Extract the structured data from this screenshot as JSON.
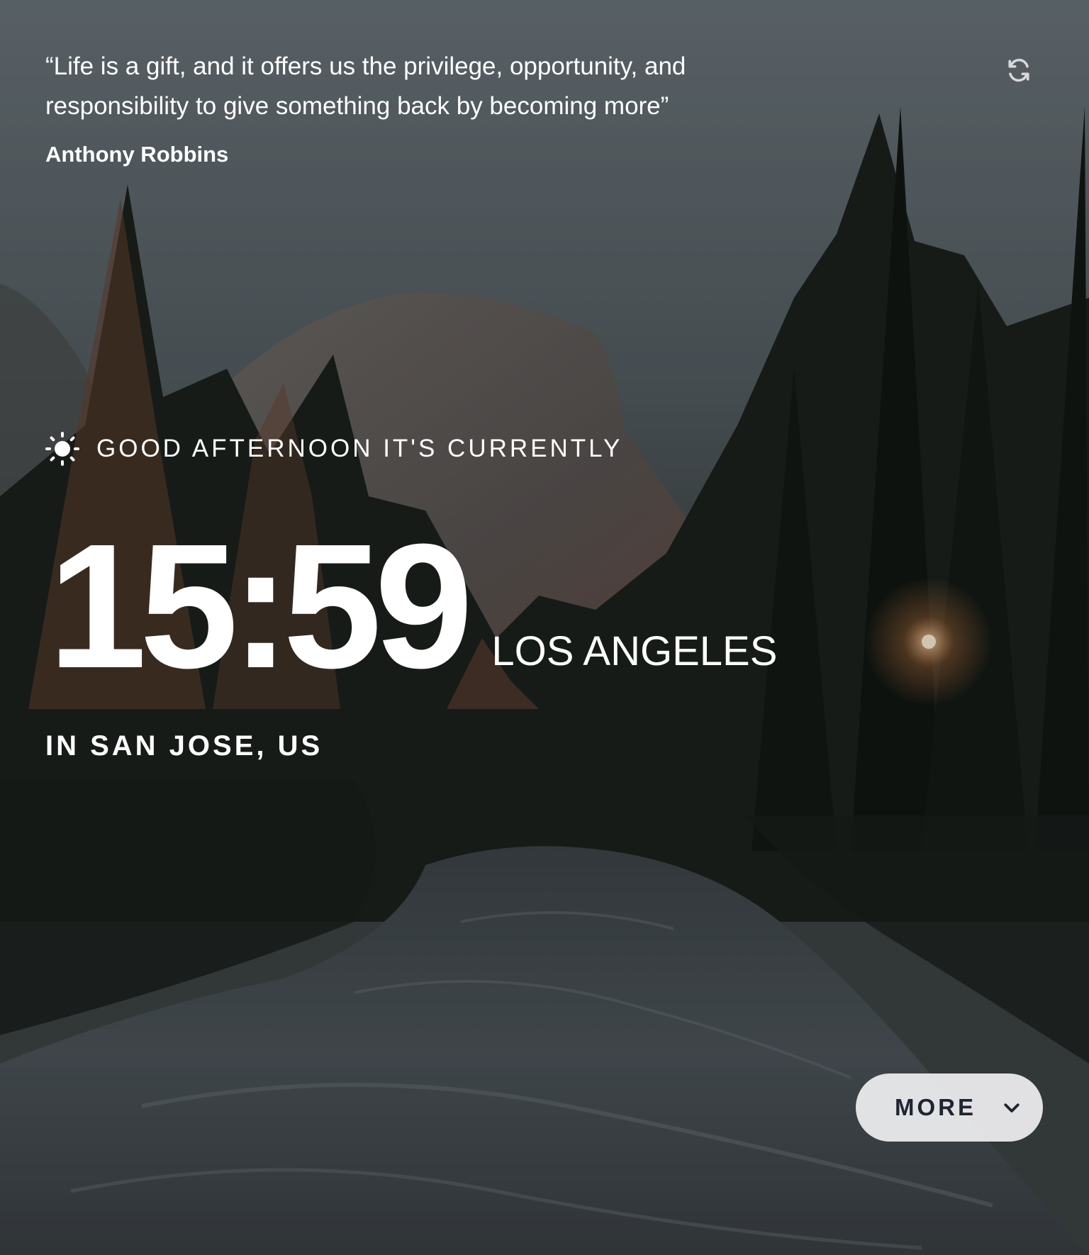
{
  "quote": {
    "text": "“Life is a gift, and it offers us the privilege, opportunity, and responsibility to give something back by becoming more”",
    "author": "Anthony Robbins",
    "refresh_icon": "refresh-icon"
  },
  "greeting": {
    "icon": "sun-icon",
    "text": "GOOD AFTERNOON IT'S CURRENTLY"
  },
  "clock": {
    "time": "15:59",
    "timezone": "LOS ANGELES"
  },
  "location": {
    "text": "IN SAN JOSE, US"
  },
  "more_button": {
    "label": "MORE",
    "icon": "chevron-down-icon"
  },
  "colors": {
    "text": "#ffffff",
    "button_bg": "#f0f0f2",
    "button_text": "#1f2430"
  }
}
